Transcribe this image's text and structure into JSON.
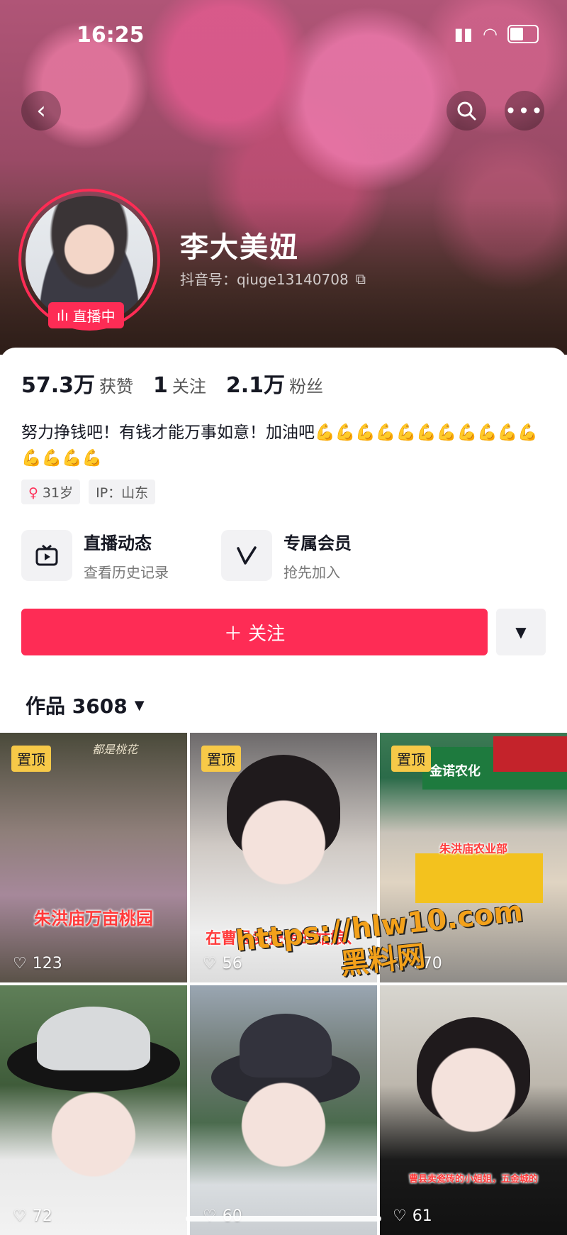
{
  "status_bar": {
    "time": "16:25",
    "battery": "4"
  },
  "profile": {
    "name": "李大美妞",
    "douyin_id": "抖音号：qiuge13140708",
    "live_badge": "直播中"
  },
  "stats": [
    {
      "value": "57.3万",
      "label": "获赞"
    },
    {
      "value": "1",
      "label": "关注"
    },
    {
      "value": "2.1万",
      "label": "粉丝"
    }
  ],
  "bio": "努力挣钱吧！有钱才能万事如意！加油吧💪💪💪💪💪💪💪💪💪💪💪💪💪💪💪",
  "tags": {
    "age": "31岁",
    "ip": "IP：山东"
  },
  "features": [
    {
      "title": "直播动态",
      "sub": "查看历史记录",
      "icon": "tv-icon"
    },
    {
      "title": "专属会员",
      "sub": "抢先加入",
      "icon": "v-icon"
    }
  ],
  "follow_button": "＋ 关注",
  "works_tab": "作品 3608",
  "videos": [
    {
      "pinned": "置顶",
      "caption": "朱洪庙万亩桃园",
      "likes": "123",
      "overlay": "都是桃花"
    },
    {
      "pinned": "置顶",
      "caption": "在曹县卖瓷砖的姑娘、",
      "likes": "56"
    },
    {
      "pinned": "置顶",
      "caption": "朱洪庙农业部",
      "likes": "670",
      "overlay": "金诺农化"
    },
    {
      "pinned": "",
      "caption": "",
      "likes": "72"
    },
    {
      "pinned": "",
      "caption": "",
      "likes": "60"
    },
    {
      "pinned": "",
      "caption": "曹县卖瓷砖的小姐姐，五金城的",
      "likes": "61"
    }
  ],
  "watermark": {
    "line1": "https://hlw10.com",
    "line2": "黑料网"
  }
}
